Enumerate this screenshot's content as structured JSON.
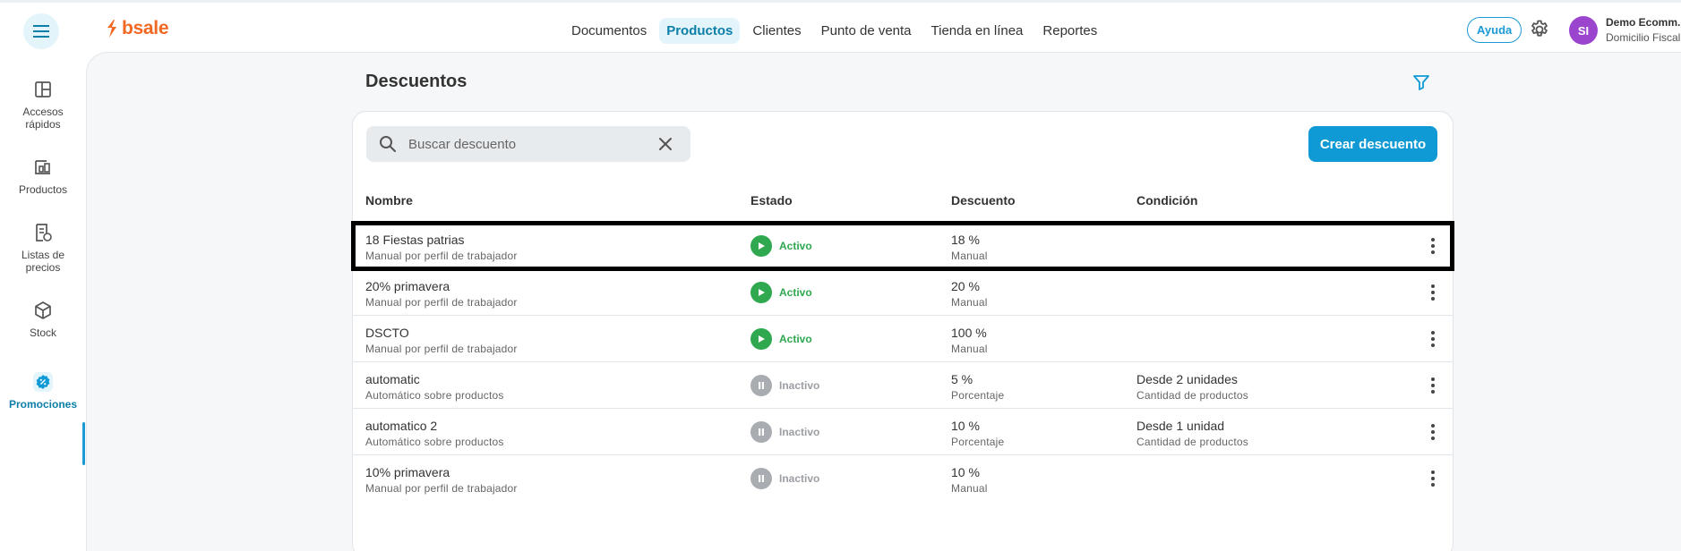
{
  "app": {
    "brand": "bsale",
    "menu_icon": "hamburger-icon",
    "brand_color": "#f26722",
    "accent_color": "#0f9ad6"
  },
  "nav": {
    "items": [
      {
        "label": "Documentos",
        "active": false
      },
      {
        "label": "Productos",
        "active": true
      },
      {
        "label": "Clientes",
        "active": false
      },
      {
        "label": "Punto de venta",
        "active": false
      },
      {
        "label": "Tienda en línea",
        "active": false
      },
      {
        "label": "Reportes",
        "active": false
      }
    ]
  },
  "header": {
    "help_label": "Ayuda",
    "settings_icon": "gear-icon",
    "avatar_initials": "SI",
    "user_name": "Demo Ecomm.",
    "user_subtitle": "Domicilio Fiscal"
  },
  "sidebar": {
    "items": [
      {
        "label_line1": "Accesos",
        "label_line2": "rápidos",
        "icon": "layout-icon",
        "active": false
      },
      {
        "label_line1": "Productos",
        "label_line2": "",
        "icon": "products-icon",
        "active": false
      },
      {
        "label_line1": "Listas de",
        "label_line2": "precios",
        "icon": "price-list-icon",
        "active": false
      },
      {
        "label_line1": "Stock",
        "label_line2": "",
        "icon": "box-icon",
        "active": false
      },
      {
        "label_line1": "Promociones",
        "label_line2": "",
        "icon": "percent-badge-icon",
        "active": true
      }
    ]
  },
  "main": {
    "title": "Descuentos",
    "filter_icon": "filter-icon",
    "search": {
      "placeholder": "Buscar descuento",
      "value": ""
    },
    "create_label": "Crear descuento",
    "columns": [
      "Nombre",
      "Estado",
      "Descuento",
      "Condición"
    ],
    "rows": [
      {
        "name": "18 Fiestas patrias",
        "type": "Manual por perfil de trabajador",
        "status": "Activo",
        "active": true,
        "value": "18 %",
        "value_type": "Manual",
        "condition": "",
        "condition_type": "",
        "highlighted": true
      },
      {
        "name": "20% primavera",
        "type": "Manual por perfil de trabajador",
        "status": "Activo",
        "active": true,
        "value": "20 %",
        "value_type": "Manual",
        "condition": "",
        "condition_type": "",
        "highlighted": false
      },
      {
        "name": "DSCTO",
        "type": "Manual por perfil de trabajador",
        "status": "Activo",
        "active": true,
        "value": "100 %",
        "value_type": "Manual",
        "condition": "",
        "condition_type": "",
        "highlighted": false
      },
      {
        "name": "automatic",
        "type": "Automático sobre productos",
        "status": "Inactivo",
        "active": false,
        "value": "5 %",
        "value_type": "Porcentaje",
        "condition": "Desde 2 unidades",
        "condition_type": "Cantidad de productos",
        "highlighted": false
      },
      {
        "name": "automatico 2",
        "type": "Automático sobre productos",
        "status": "Inactivo",
        "active": false,
        "value": "10 %",
        "value_type": "Porcentaje",
        "condition": "Desde 1 unidad",
        "condition_type": "Cantidad de productos",
        "highlighted": false
      },
      {
        "name": "10% primavera",
        "type": "Manual por perfil de trabajador",
        "status": "Inactivo",
        "active": false,
        "value": "10 %",
        "value_type": "Manual",
        "condition": "",
        "condition_type": "",
        "highlighted": false
      }
    ]
  }
}
